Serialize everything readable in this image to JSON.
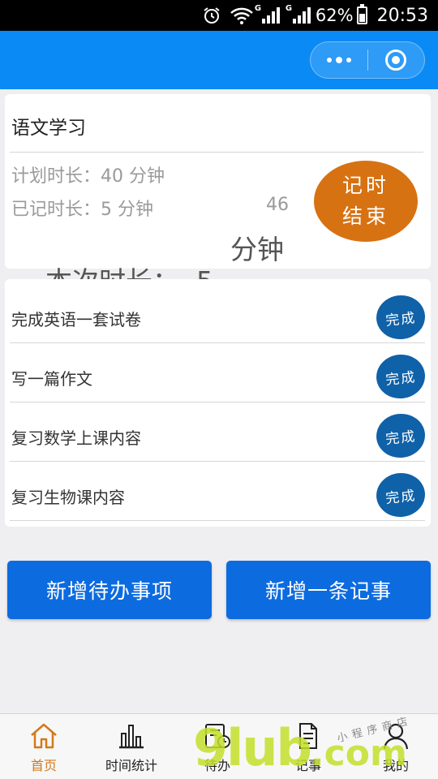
{
  "status_bar": {
    "network_label_1": "G",
    "network_label_2": "G",
    "battery": "62%",
    "time": "20:53"
  },
  "timer": {
    "subject": "语文学习",
    "planned": "计划时长：40 分钟",
    "logged": "已记时长：5 分钟",
    "seconds": "46",
    "session_label": "本次时长：  5",
    "session_unit": "分钟",
    "end_line1": "记时",
    "end_line2": "结束"
  },
  "todos": [
    {
      "text": "完成英语一套试卷",
      "action": "完成"
    },
    {
      "text": "写一篇作文",
      "action": "完成"
    },
    {
      "text": "复习数学上课内容",
      "action": "完成"
    },
    {
      "text": "复习生物课内容",
      "action": "完成"
    }
  ],
  "actions": {
    "add_todo": "新增待办事项",
    "add_note": "新增一条记事"
  },
  "tabs": [
    {
      "label": "首页",
      "icon": "home-icon",
      "active": true
    },
    {
      "label": "时间统计",
      "icon": "bar-chart-icon",
      "active": false
    },
    {
      "label": "待办",
      "icon": "clock-list-icon",
      "active": false
    },
    {
      "label": "记事",
      "icon": "txt-file-icon",
      "active": false
    },
    {
      "label": "我的",
      "icon": "user-icon",
      "active": false
    }
  ],
  "watermark": {
    "text": "9lub",
    "suffix": ".com",
    "handwritten": "小程序商店"
  },
  "colors": {
    "nav": "#0a8af5",
    "end_button": "#d77213",
    "done_button": "#0f61a8",
    "action_button": "#0d6be0",
    "active_tab": "#d27a18"
  }
}
